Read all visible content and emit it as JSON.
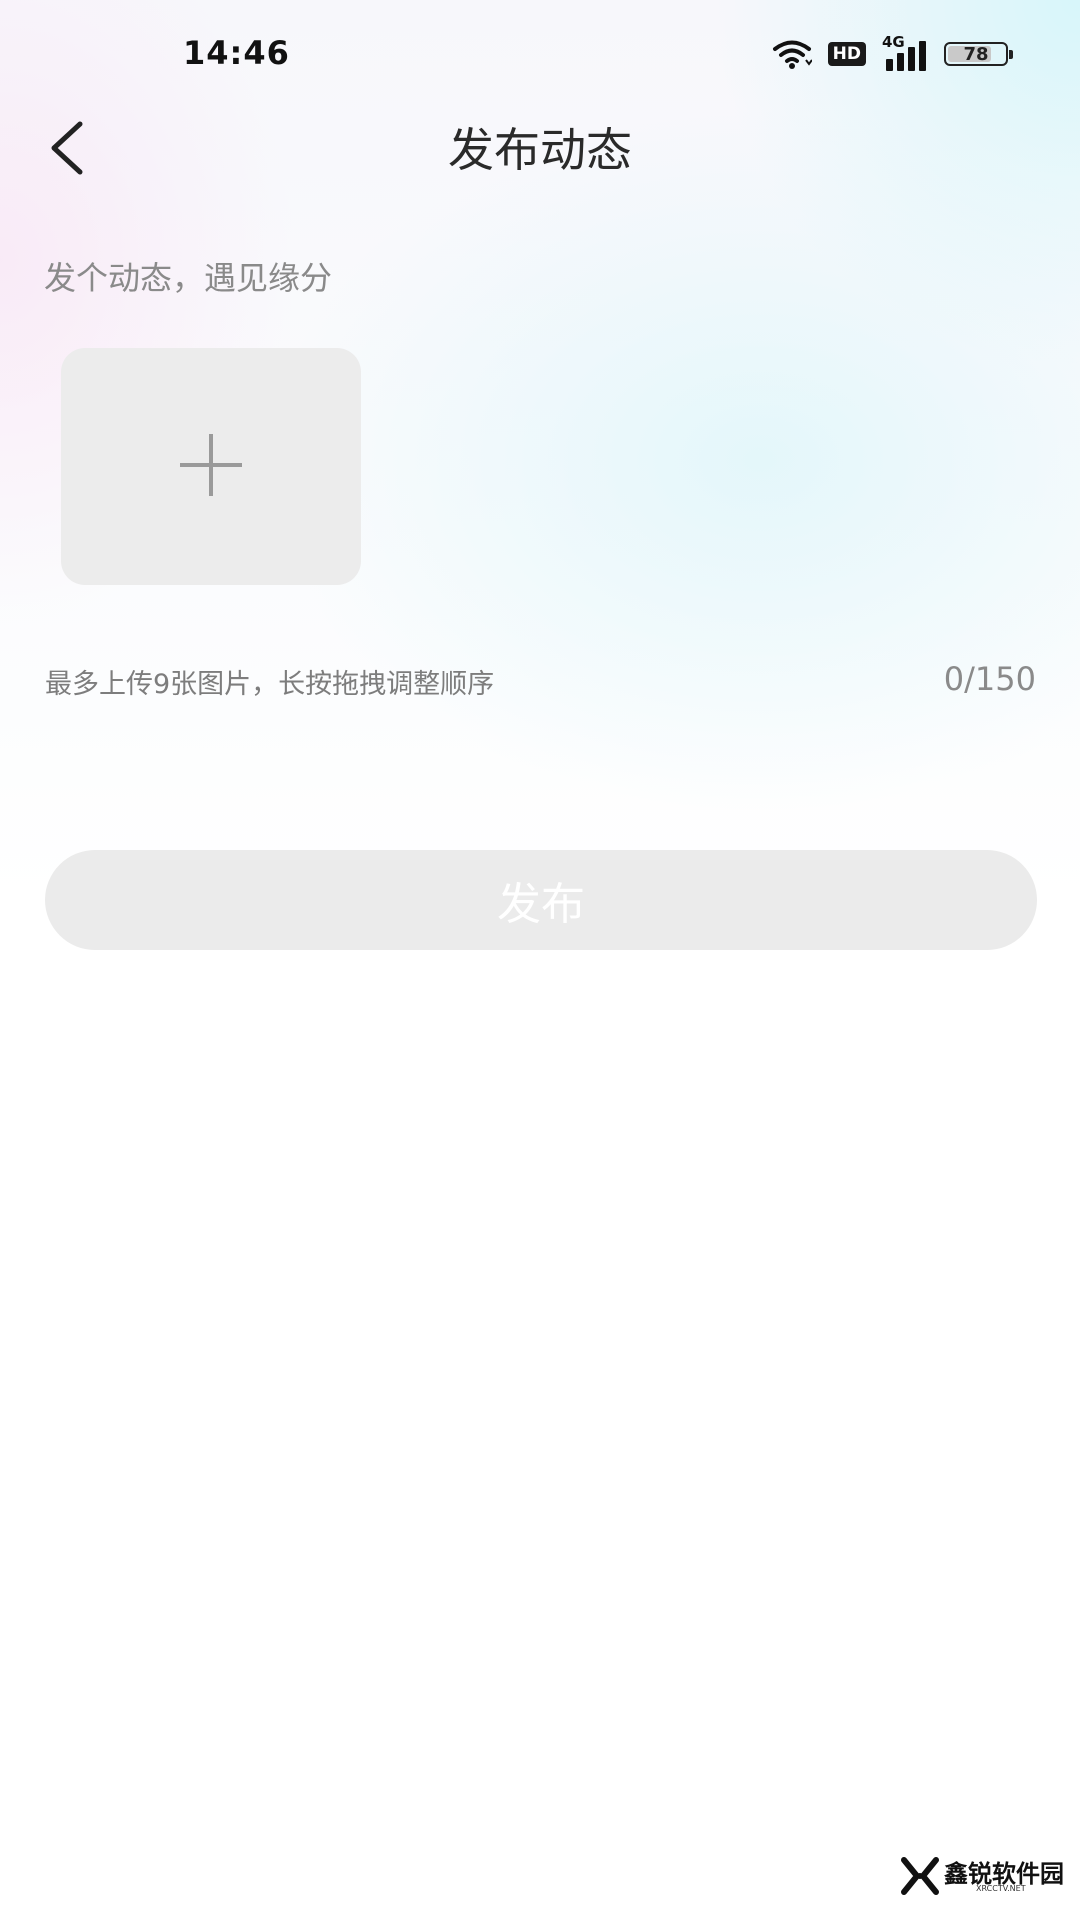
{
  "status_bar": {
    "time": "14:46",
    "hd_label": "HD",
    "network_label": "4G",
    "battery_level": "78",
    "battery_percent": 78
  },
  "header": {
    "title": "发布动态"
  },
  "post": {
    "placeholder": "发个动态，遇见缘分",
    "upload_hint": "最多上传9张图片，长按拖拽调整顺序",
    "char_count": "0/150"
  },
  "actions": {
    "publish_label": "发布"
  },
  "icons": {
    "back": "chevron-left-icon",
    "add_photo": "plus-icon",
    "wifi": "wifi-icon",
    "signal": "signal-icon",
    "battery": "battery-icon"
  },
  "colors": {
    "publish_button_disabled": "#ebebeb",
    "add_tile": "#ececec",
    "hint_text": "#7d7d7d"
  },
  "watermark": {
    "name": "鑫锐软件园",
    "domain": "XRCCTV.NET"
  }
}
